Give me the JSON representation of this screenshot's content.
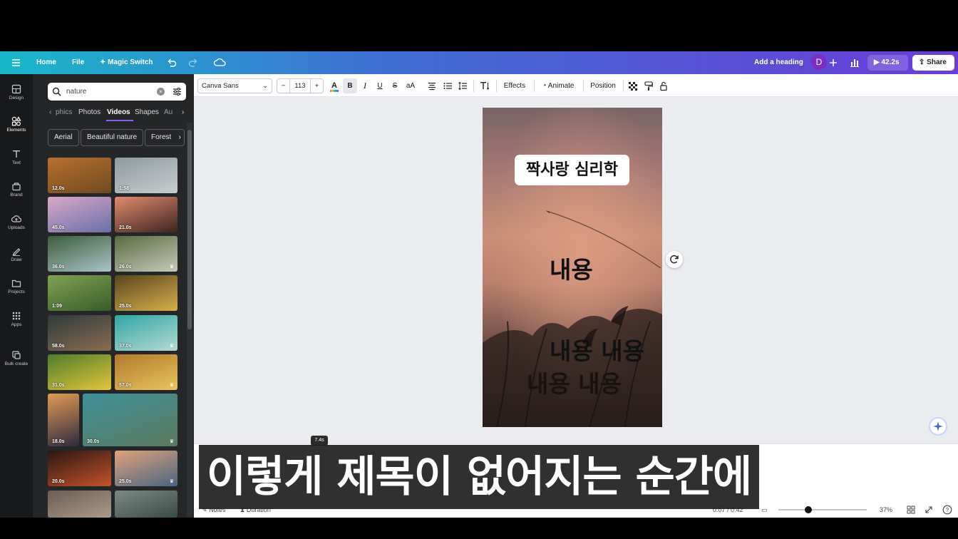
{
  "topbar": {
    "home": "Home",
    "file": "File",
    "magic_switch": "Magic Switch",
    "add_heading": "Add a heading",
    "avatar_initial": "D",
    "duration": "42.2s",
    "share": "Share"
  },
  "rail": {
    "items": [
      "Design",
      "Elements",
      "Text",
      "Brand",
      "Uploads",
      "Draw",
      "Projects",
      "Apps",
      "Bulk create"
    ]
  },
  "panel": {
    "search_value": "nature",
    "tabs": [
      "phics",
      "Photos",
      "Videos",
      "Shapes",
      "Au"
    ],
    "active_tab": "Videos",
    "chips": [
      "Aerial",
      "Beautiful nature",
      "Forest"
    ],
    "thumbnails": [
      {
        "duration": "12.0s",
        "colors": [
          "#b8702d",
          "#6f4a21"
        ],
        "crown": false
      },
      {
        "duration": "1:58",
        "colors": [
          "#8e9a9e",
          "#c7cdd0"
        ],
        "crown": false
      },
      {
        "duration": "45.0s",
        "colors": [
          "#d9a8c8",
          "#6b6fa8"
        ],
        "crown": false
      },
      {
        "duration": "21.0s",
        "colors": [
          "#e28b6f",
          "#3c241e"
        ],
        "crown": false
      },
      {
        "duration": "36.0s",
        "colors": [
          "#3d5c3a",
          "#a9c4c9"
        ],
        "crown": false
      },
      {
        "duration": "26.0s",
        "colors": [
          "#5a6b3f",
          "#c6c9b9"
        ],
        "crown": true
      },
      {
        "duration": "1:09",
        "colors": [
          "#7fa352",
          "#385c2a"
        ],
        "crown": false
      },
      {
        "duration": "25.0s",
        "colors": [
          "#5a4520",
          "#d6b04a"
        ],
        "crown": false
      },
      {
        "duration": "58.0s",
        "colors": [
          "#2e3a3c",
          "#8a6d4f"
        ],
        "crown": false
      },
      {
        "duration": "37.0s",
        "colors": [
          "#2ea7a5",
          "#b7d9d4"
        ],
        "crown": true
      },
      {
        "duration": "31.0s",
        "colors": [
          "#4e7d2c",
          "#e4c53a"
        ],
        "crown": false
      },
      {
        "duration": "57.0s",
        "colors": [
          "#b27a2a",
          "#e8c45e"
        ],
        "crown": true
      },
      {
        "duration": "18.0s",
        "colors": [
          "#e39a54",
          "#2d2b3e"
        ],
        "crown": false
      },
      {
        "duration": "30.0s",
        "colors": [
          "#3e8f9a",
          "#5c7a5e"
        ],
        "crown": true
      },
      {
        "duration": "20.0s",
        "colors": [
          "#2a1712",
          "#c5522b"
        ],
        "crown": false
      },
      {
        "duration": "25.0s",
        "colors": [
          "#e0a27a",
          "#4a6583"
        ],
        "crown": true
      },
      {
        "duration": "",
        "colors": [
          "#6d5d52",
          "#a99a8a"
        ],
        "crown": false
      },
      {
        "duration": "",
        "colors": [
          "#7c8a86",
          "#3a4a45"
        ],
        "crown": false
      }
    ]
  },
  "toolbar": {
    "font": "Canva Sans",
    "font_size": "113",
    "minus": "−",
    "plus": "+",
    "effects": "Effects",
    "animate": "Animate",
    "position": "Position"
  },
  "canvas": {
    "title": "짝사랑 심리학",
    "body1": "내용",
    "body2": "내용 내용",
    "body3": "내용 내용"
  },
  "timeline": {
    "tooltip": "7.4s",
    "notes": "Notes",
    "duration": "Duration",
    "time": "0:07 / 0:42",
    "zoom": "37%",
    "zoom_fraction": 0.37
  },
  "subtitle": "이렇게 제목이 없어지는 순간에"
}
